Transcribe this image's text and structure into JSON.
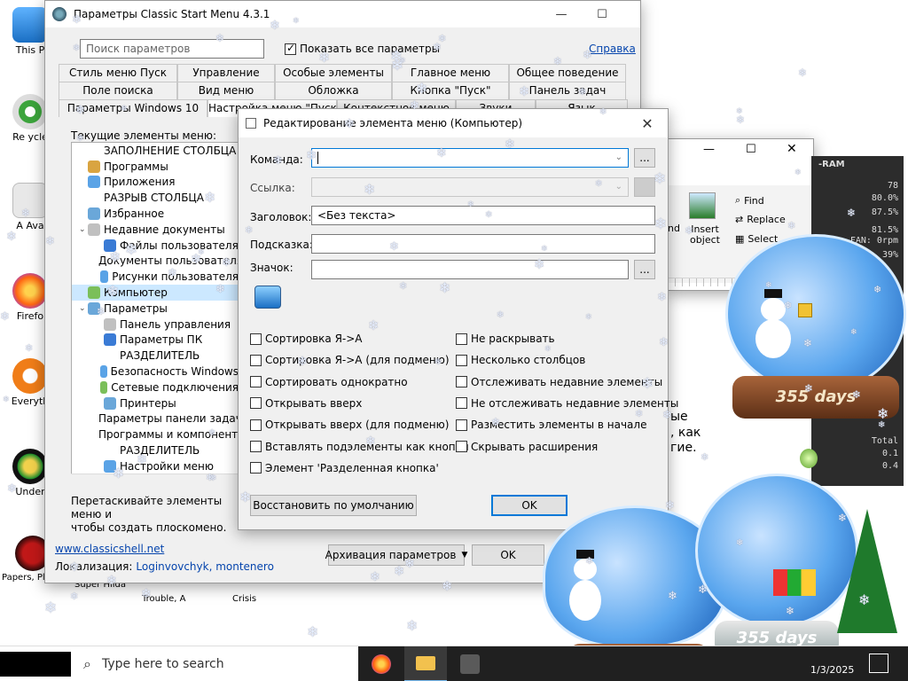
{
  "desktop": {
    "icons": [
      {
        "label": "This P",
        "icon": "this-pc-icon"
      },
      {
        "label": "Re ycle",
        "icon": "recycle-bin-icon"
      },
      {
        "label": "A  Ava",
        "icon": "avast-icon"
      },
      {
        "label": "Firefo",
        "icon": "firefox-icon"
      },
      {
        "label": "Everyth",
        "icon": "everything-icon"
      },
      {
        "label": "Under",
        "icon": "undertale-icon"
      },
      {
        "label": "Papers, Please",
        "icon": "papers-please-icon"
      }
    ],
    "extra_labels": [
      "Super Hilda",
      "Trouble, A",
      "Crisis"
    ]
  },
  "settings_window": {
    "title": "Параметры Classic Start Menu 4.3.1",
    "search_placeholder": "Поиск параметров",
    "show_all_label": "Показать все параметры",
    "help_link": "Справка",
    "tabs_row1": [
      "Стиль меню Пуск",
      "Управление",
      "Особые элементы",
      "Главное меню",
      "Общее поведение"
    ],
    "tabs_row2": [
      "Поле поиска",
      "Вид меню",
      "Обложка",
      "Кнопка \"Пуск\"",
      "Панель задач"
    ],
    "tabs_row3": [
      "Параметры Windows 10",
      "Настройка меню \"Пуск\"",
      "Контекстное меню",
      "Звуки",
      "Язык"
    ],
    "current_items_label": "Текущие элементы меню:",
    "tree_items": [
      {
        "label": "ЗАПОЛНЕНИЕ СТОЛБЦА",
        "indent": 1,
        "icon": "",
        "exp": ""
      },
      {
        "label": "Программы",
        "indent": 1,
        "icon": "programs-icon",
        "exp": ""
      },
      {
        "label": "Приложения",
        "indent": 1,
        "icon": "apps-icon",
        "exp": ""
      },
      {
        "label": "РАЗРЫВ СТОЛБЦА",
        "indent": 1,
        "icon": "",
        "exp": ""
      },
      {
        "label": "Избранное",
        "indent": 1,
        "icon": "favorites-icon",
        "exp": ""
      },
      {
        "label": "Недавние документы",
        "indent": 1,
        "icon": "recent-docs-icon",
        "exp": "v"
      },
      {
        "label": "Файлы пользователя",
        "indent": 2,
        "icon": "user-files-icon",
        "exp": ""
      },
      {
        "label": "Документы пользователя",
        "indent": 2,
        "icon": "user-docs-icon",
        "exp": ""
      },
      {
        "label": "Рисунки пользователя",
        "indent": 2,
        "icon": "user-pictures-icon",
        "exp": ""
      },
      {
        "label": "Компьютер",
        "indent": 1,
        "icon": "computer-icon",
        "exp": ""
      },
      {
        "label": "Параметры",
        "indent": 1,
        "icon": "settings-icon",
        "exp": "v"
      },
      {
        "label": "Панель управления",
        "indent": 2,
        "icon": "control-panel-icon",
        "exp": ""
      },
      {
        "label": "Параметры ПК",
        "indent": 2,
        "icon": "pc-settings-icon",
        "exp": ""
      },
      {
        "label": "РАЗДЕЛИТЕЛЬ",
        "indent": 2,
        "icon": "",
        "exp": ""
      },
      {
        "label": "Безопасность Windows",
        "indent": 2,
        "icon": "security-icon",
        "exp": ""
      },
      {
        "label": "Сетевые подключения",
        "indent": 2,
        "icon": "network-icon",
        "exp": ""
      },
      {
        "label": "Принтеры",
        "indent": 2,
        "icon": "printers-icon",
        "exp": ""
      },
      {
        "label": "Параметры панели задач",
        "indent": 2,
        "icon": "taskbar-settings-icon",
        "exp": ""
      },
      {
        "label": "Программы и компоненты",
        "indent": 2,
        "icon": "programs-features-icon",
        "exp": ""
      },
      {
        "label": "РАЗДЕЛИТЕЛЬ",
        "indent": 2,
        "icon": "",
        "exp": ""
      },
      {
        "label": "Настройки меню",
        "indent": 2,
        "icon": "menu-settings-icon",
        "exp": ""
      }
    ],
    "hint": "Перетаскивайте элементы меню и чтобы создать плоскомено.",
    "hint_line1": "Перетаскивайте элементы меню и",
    "hint_line2": "чтобы создать плоскомено.",
    "website": "www.classicshell.net",
    "localization_label": "Локализация:",
    "localization_author": "Loginvovchyk, montenero",
    "backup_button": "Архивация параметров",
    "ok_button": "OK"
  },
  "edit_dialog": {
    "title": "Редактирование элемента меню (Компьютер)",
    "command_label": "Команда:",
    "command_value": "",
    "link_label": "Ссылка:",
    "link_value": "",
    "caption_label": "Заголовок:",
    "caption_value": "<Без текста>",
    "tooltip_label": "Подсказка:",
    "tooltip_value": "",
    "icon_label": "Значок:",
    "icon_value": "",
    "browse_label": "...",
    "options_left": [
      "Сортировка Я->А",
      "Сортировка Я->А (для подменю)",
      "Сортировать однократно",
      "Открывать вверх",
      "Открывать вверх (для подменю)",
      "Вставлять подэлементы как кнопки",
      "Элемент 'Разделенная кнопка'"
    ],
    "options_right": [
      "Не раскрывать",
      "Несколько столбцов",
      "Отслеживать недавние элементы",
      "Не отслеживать недавние элементы",
      "Разместить элементы в начале",
      "Скрывать расширения"
    ],
    "restore_button": "Восстановить по умолчанию",
    "ok_button": "OK"
  },
  "right_window": {
    "ribbon": {
      "find": "Find",
      "replace": "Replace",
      "select": "Select",
      "insert_object": "Insert object",
      "nd": "nd"
    },
    "text_fragments": [
      "ые",
      ", как",
      "гие."
    ]
  },
  "monitor": {
    "title": "-RAM",
    "values": [
      "78",
      "80.0%",
      "87.5%",
      "81.5%",
      "FAN: 0rpm",
      "39%",
      "Total",
      "0.1",
      "0.4"
    ]
  },
  "snowglobes": {
    "days_label": "355 days"
  },
  "taskbar": {
    "search_placeholder": "Type here to search",
    "date": "1/3/2025"
  }
}
